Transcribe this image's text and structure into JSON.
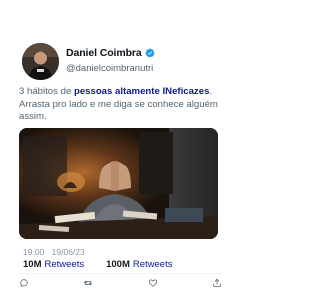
{
  "author": {
    "name": "Daniel Coimbra",
    "handle": "@danielcoimbranutri",
    "verified": true
  },
  "tweet": {
    "part1": "3 hábitos de ",
    "highlight": "pessoas altamente INeficazes",
    "part2": ". Arrasta pro lado e me diga se conhece alguém assim."
  },
  "meta": {
    "time": "19:00",
    "date": "19/06/23"
  },
  "stats": [
    {
      "count": "10M",
      "label": "Retweets"
    },
    {
      "count": "100M",
      "label": "Retweets"
    }
  ],
  "icons": {
    "reply": "comment-icon",
    "retweet": "retweet-icon",
    "like": "heart-icon",
    "share": "share-icon",
    "verified": "verified-badge-icon"
  },
  "colors": {
    "accent_text": "#0b1a8f",
    "verified": "#1d9bf0",
    "muted": "#536471"
  }
}
